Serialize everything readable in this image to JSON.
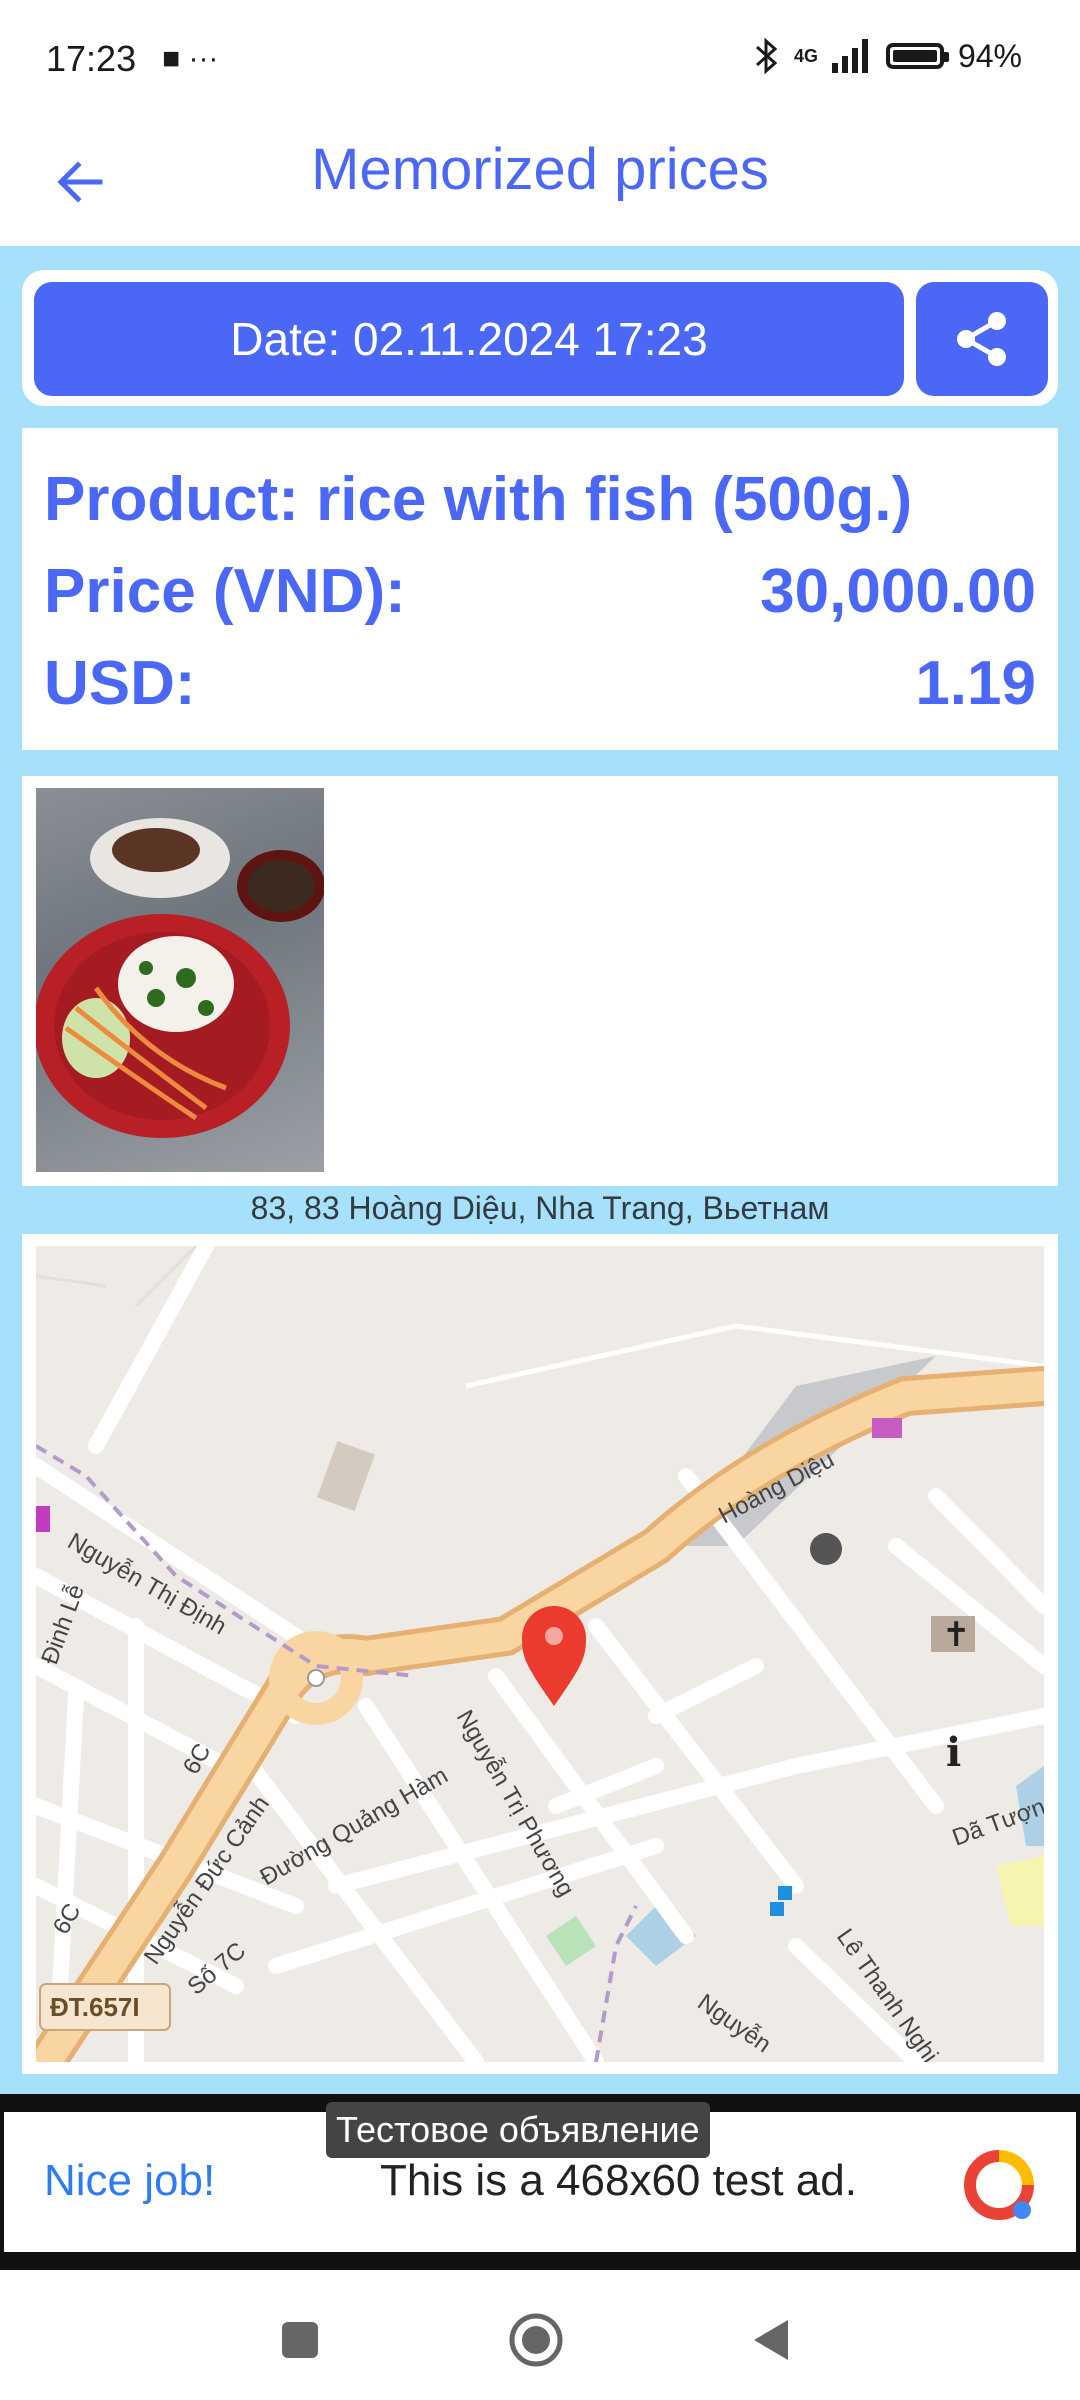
{
  "status_bar": {
    "time": "17:23",
    "extra_icons": "■ ···",
    "network": "4G",
    "battery": "94%"
  },
  "app_bar": {
    "title": "Memorized prices",
    "back_icon": "arrow-left-icon"
  },
  "record": {
    "date_label": "Date: 02.11.2024 17:23",
    "share_icon": "share-icon",
    "product_label": "Product: rice with fish (500g.)",
    "price_label": "Price (VND):",
    "price_value": "30,000.00",
    "usd_label": "USD:",
    "usd_value": "1.19",
    "address": "83, 83 Hoàng Diệu, Nha Trang, Вьетнам"
  },
  "map": {
    "labels": [
      "Hoàng Diệu",
      "Nguyễn Thị Định",
      "Nguyễn Đức Cảnh",
      "Đường Quảng Hàm",
      "Nguyễn Trị Phương",
      "Đinh Lễ",
      "6C",
      "6C",
      "Số 7C",
      "Lê Thanh Nghị",
      "Dã Tượng",
      "Nguyễn",
      "ĐT.657I"
    ],
    "marker_icon": "location-pin-icon"
  },
  "ad": {
    "tag": "Тестовое объявление",
    "headline": "Nice job!",
    "text": "This is a 468x60 test ad."
  },
  "nav": {
    "recents_icon": "square-icon",
    "home_icon": "circle-icon",
    "back_icon": "triangle-back-icon"
  },
  "colors": {
    "primary": "#4a68f5",
    "background": "#a6e0fb",
    "pin": "#ea3b2e"
  }
}
